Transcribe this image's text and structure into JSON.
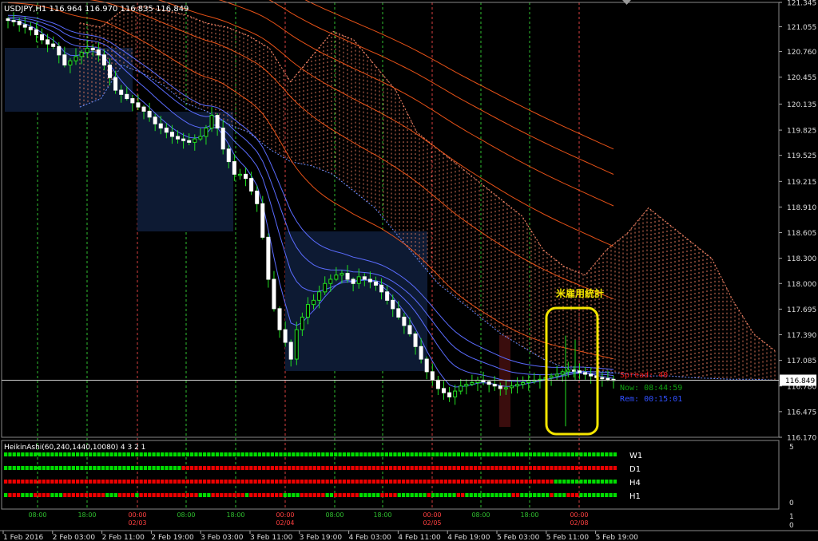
{
  "window": {
    "symbol_line": "USDJPY,H1  116.964 116.970 116.835 116.849"
  },
  "annotation": {
    "text": "米雇用統計",
    "color": "#f5e600"
  },
  "info": {
    "spread": "Spread: 40",
    "now": "Now: 08:44:59",
    "rem": "Rem: 00:15:01"
  },
  "colors": {
    "bull": "#22e022",
    "bear": "#ffffff",
    "cloud": "#ff8a6a",
    "cloud_blue": "#6a8cff",
    "fast_ma": "#5b6cff",
    "slow_ma": "#ff5a1a",
    "grid_green": "#2fbf2f",
    "grid_red": "#d84040",
    "up_cell": "#00dd00",
    "down_cell": "#ee0000"
  },
  "chart_data": {
    "type": "candlestick",
    "title": "USDJPY,H1",
    "ohlc_last": {
      "open": 116.964,
      "high": 116.97,
      "low": 116.835,
      "close": 116.849
    },
    "price_axis_ticks": [
      "121.345",
      "121.055",
      "120.760",
      "120.455",
      "120.135",
      "119.825",
      "119.525",
      "119.215",
      "118.910",
      "118.605",
      "118.300",
      "118.000",
      "117.695",
      "117.390",
      "117.085",
      "116.780",
      "116.475",
      "116.170"
    ],
    "current_price": "116.849",
    "ylim": [
      116.17,
      121.345
    ],
    "time_axis_ticks": [
      "1 Feb 2016",
      "2 Feb 03:00",
      "2 Feb 11:00",
      "2 Feb 19:00",
      "3 Feb 03:00",
      "3 Feb 11:00",
      "3 Feb 19:00",
      "4 Feb 03:00",
      "4 Feb 11:00",
      "4 Feb 19:00",
      "5 Feb 03:00",
      "5 Feb 11:00",
      "5 Feb 19:00"
    ],
    "session_labels": [
      {
        "time": "08:00"
      },
      {
        "time": "18:00"
      },
      {
        "time": "00:00",
        "date": "02/03"
      },
      {
        "time": "08:00"
      },
      {
        "time": "18:00"
      },
      {
        "time": "00:00",
        "date": "02/04"
      },
      {
        "time": "08:00"
      },
      {
        "time": "18:00"
      },
      {
        "time": "00:00",
        "date": "02/05"
      },
      {
        "time": "08:00"
      },
      {
        "time": "18:00"
      },
      {
        "time": "00:00",
        "date": "02/08"
      }
    ],
    "closes": [
      121.13,
      121.12,
      121.08,
      121.05,
      121.02,
      120.96,
      120.9,
      120.85,
      120.82,
      120.72,
      120.6,
      120.65,
      120.7,
      120.75,
      120.8,
      120.78,
      120.72,
      120.6,
      120.45,
      120.3,
      120.25,
      120.2,
      120.15,
      120.1,
      120.05,
      119.98,
      119.9,
      119.85,
      119.8,
      119.75,
      119.72,
      119.7,
      119.68,
      119.72,
      119.75,
      119.85,
      120.0,
      119.85,
      119.6,
      119.45,
      119.3,
      119.3,
      119.25,
      119.1,
      118.95,
      118.55,
      118.05,
      117.7,
      117.45,
      117.3,
      117.1,
      117.45,
      117.6,
      117.75,
      117.8,
      117.9,
      118.0,
      118.05,
      118.1,
      118.12,
      118.05,
      118.0,
      118.08,
      118.05,
      118.02,
      117.98,
      117.9,
      117.8,
      117.7,
      117.6,
      117.5,
      117.4,
      117.25,
      117.1,
      116.95,
      116.85,
      116.75,
      116.7,
      116.65,
      116.72,
      116.78,
      116.8,
      116.82,
      116.85,
      116.83,
      116.8,
      116.78,
      116.75,
      116.76,
      116.78,
      116.8,
      116.82,
      116.84,
      116.85,
      116.86,
      116.88,
      116.9,
      116.92,
      116.95,
      116.97,
      116.96,
      116.94,
      116.92,
      116.9,
      116.88,
      116.87,
      116.86,
      116.85
    ],
    "ma_fast_offsets": [
      0.15,
      0.3,
      0.45,
      0.6
    ],
    "ma_slow_offsets": [
      0.35,
      0.55,
      0.8,
      1.05,
      1.35,
      1.7
    ],
    "ichimoku_cloud": {
      "upper": [
        121.1,
        121.05,
        121.25,
        121.3,
        121.25,
        121.2,
        121.1,
        121.05,
        120.95,
        120.8,
        120.4,
        120.7,
        121.0,
        120.9,
        120.6,
        120.3,
        119.8,
        119.6,
        119.4,
        119.2,
        119.0,
        118.8,
        118.4,
        118.2,
        118.1,
        118.4,
        118.6,
        118.9,
        118.7,
        118.5,
        118.3,
        117.8,
        117.4,
        117.2
      ],
      "lower": [
        120.1,
        120.2,
        120.6,
        120.5,
        120.35,
        120.15,
        120.05,
        119.9,
        119.8,
        119.6,
        119.45,
        119.4,
        119.3,
        119.1,
        118.9,
        118.6,
        118.3,
        118.0,
        117.8,
        117.6,
        117.4,
        117.25,
        117.1,
        117.0,
        116.95,
        116.95,
        116.92,
        116.9,
        116.9,
        116.88,
        116.87,
        116.86,
        116.86,
        116.85
      ]
    },
    "sub_window": {
      "label": "HeikinAshi(60,240,1440,10080) 4 3 2 1",
      "rows": [
        "W1",
        "D1",
        "H4",
        "H1"
      ],
      "scale_max": "5",
      "scale_min": "0",
      "direction": [
        "1111111111111111111111111111111111111111111111111111111111111111111111111111111111111111111111111111111111111111111111111111111111111111111111111",
        "1111111111111111111111111111111111111111110000000000000000000000000000000000000000000000000000000000000000000000000000000000000000000000000000000",
        "0000000000000000000000000000000000000000000000000000000000000000000000000000000000000000000000000000000000000000000000000000000000111111111111111",
        "1000111000011100000000001110000100000000000000111000000001000000001111000000110000001111100001111111011111100111111111110011111110111000111111111"
      ]
    },
    "sub_axis": {
      "top": "1",
      "bottom": "0"
    }
  }
}
